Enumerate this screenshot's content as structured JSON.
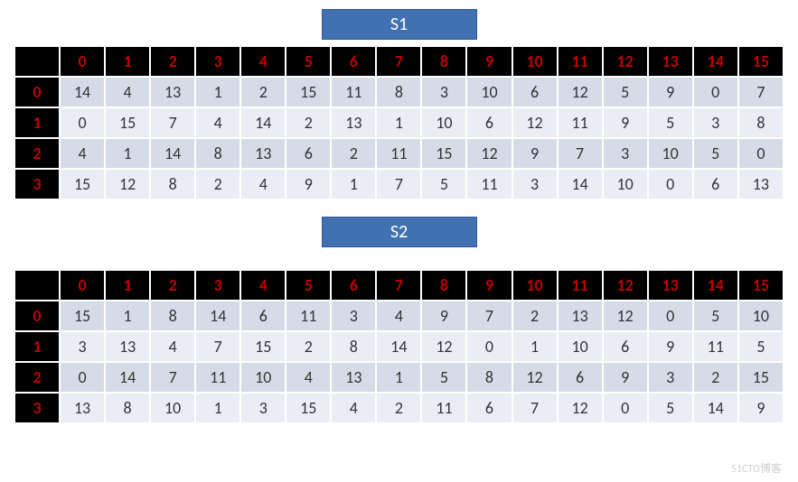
{
  "tables": [
    {
      "label": "S1",
      "cols": [
        "0",
        "1",
        "2",
        "3",
        "4",
        "5",
        "6",
        "7",
        "8",
        "9",
        "10",
        "11",
        "12",
        "13",
        "14",
        "15"
      ],
      "rows": [
        {
          "h": "0",
          "v": [
            14,
            4,
            13,
            1,
            2,
            15,
            11,
            8,
            3,
            10,
            6,
            12,
            5,
            9,
            0,
            7
          ]
        },
        {
          "h": "1",
          "v": [
            0,
            15,
            7,
            4,
            14,
            2,
            13,
            1,
            10,
            6,
            12,
            11,
            9,
            5,
            3,
            8
          ]
        },
        {
          "h": "2",
          "v": [
            4,
            1,
            14,
            8,
            13,
            6,
            2,
            11,
            15,
            12,
            9,
            7,
            3,
            10,
            5,
            0
          ]
        },
        {
          "h": "3",
          "v": [
            15,
            12,
            8,
            2,
            4,
            9,
            1,
            7,
            5,
            11,
            3,
            14,
            10,
            0,
            6,
            13
          ]
        }
      ]
    },
    {
      "label": "S2",
      "cols": [
        "0",
        "1",
        "2",
        "3",
        "4",
        "5",
        "6",
        "7",
        "8",
        "9",
        "10",
        "11",
        "12",
        "13",
        "14",
        "15"
      ],
      "rows": [
        {
          "h": "0",
          "v": [
            15,
            1,
            8,
            14,
            6,
            11,
            3,
            4,
            9,
            7,
            2,
            13,
            12,
            0,
            5,
            10
          ]
        },
        {
          "h": "1",
          "v": [
            3,
            13,
            4,
            7,
            15,
            2,
            8,
            14,
            12,
            0,
            1,
            10,
            6,
            9,
            11,
            5
          ]
        },
        {
          "h": "2",
          "v": [
            0,
            14,
            7,
            11,
            10,
            4,
            13,
            1,
            5,
            8,
            12,
            6,
            9,
            3,
            2,
            15
          ]
        },
        {
          "h": "3",
          "v": [
            13,
            8,
            10,
            1,
            3,
            15,
            4,
            2,
            11,
            6,
            7,
            12,
            0,
            5,
            14,
            9
          ]
        }
      ]
    }
  ],
  "watermark": "51CTO博客",
  "chart_data": [
    {
      "type": "table",
      "title": "S1",
      "categories": [
        "0",
        "1",
        "2",
        "3",
        "4",
        "5",
        "6",
        "7",
        "8",
        "9",
        "10",
        "11",
        "12",
        "13",
        "14",
        "15"
      ],
      "series": [
        {
          "name": "0",
          "values": [
            14,
            4,
            13,
            1,
            2,
            15,
            11,
            8,
            3,
            10,
            6,
            12,
            5,
            9,
            0,
            7
          ]
        },
        {
          "name": "1",
          "values": [
            0,
            15,
            7,
            4,
            14,
            2,
            13,
            1,
            10,
            6,
            12,
            11,
            9,
            5,
            3,
            8
          ]
        },
        {
          "name": "2",
          "values": [
            4,
            1,
            14,
            8,
            13,
            6,
            2,
            11,
            15,
            12,
            9,
            7,
            3,
            10,
            5,
            0
          ]
        },
        {
          "name": "3",
          "values": [
            15,
            12,
            8,
            2,
            4,
            9,
            1,
            7,
            5,
            11,
            3,
            14,
            10,
            0,
            6,
            13
          ]
        }
      ]
    },
    {
      "type": "table",
      "title": "S2",
      "categories": [
        "0",
        "1",
        "2",
        "3",
        "4",
        "5",
        "6",
        "7",
        "8",
        "9",
        "10",
        "11",
        "12",
        "13",
        "14",
        "15"
      ],
      "series": [
        {
          "name": "0",
          "values": [
            15,
            1,
            8,
            14,
            6,
            11,
            3,
            4,
            9,
            7,
            2,
            13,
            12,
            0,
            5,
            10
          ]
        },
        {
          "name": "1",
          "values": [
            3,
            13,
            4,
            7,
            15,
            2,
            8,
            14,
            12,
            0,
            1,
            10,
            6,
            9,
            11,
            5
          ]
        },
        {
          "name": "2",
          "values": [
            0,
            14,
            7,
            11,
            10,
            4,
            13,
            1,
            5,
            8,
            12,
            6,
            9,
            3,
            2,
            15
          ]
        },
        {
          "name": "3",
          "values": [
            13,
            8,
            10,
            1,
            3,
            15,
            4,
            2,
            11,
            6,
            7,
            12,
            0,
            5,
            14,
            9
          ]
        }
      ]
    }
  ]
}
